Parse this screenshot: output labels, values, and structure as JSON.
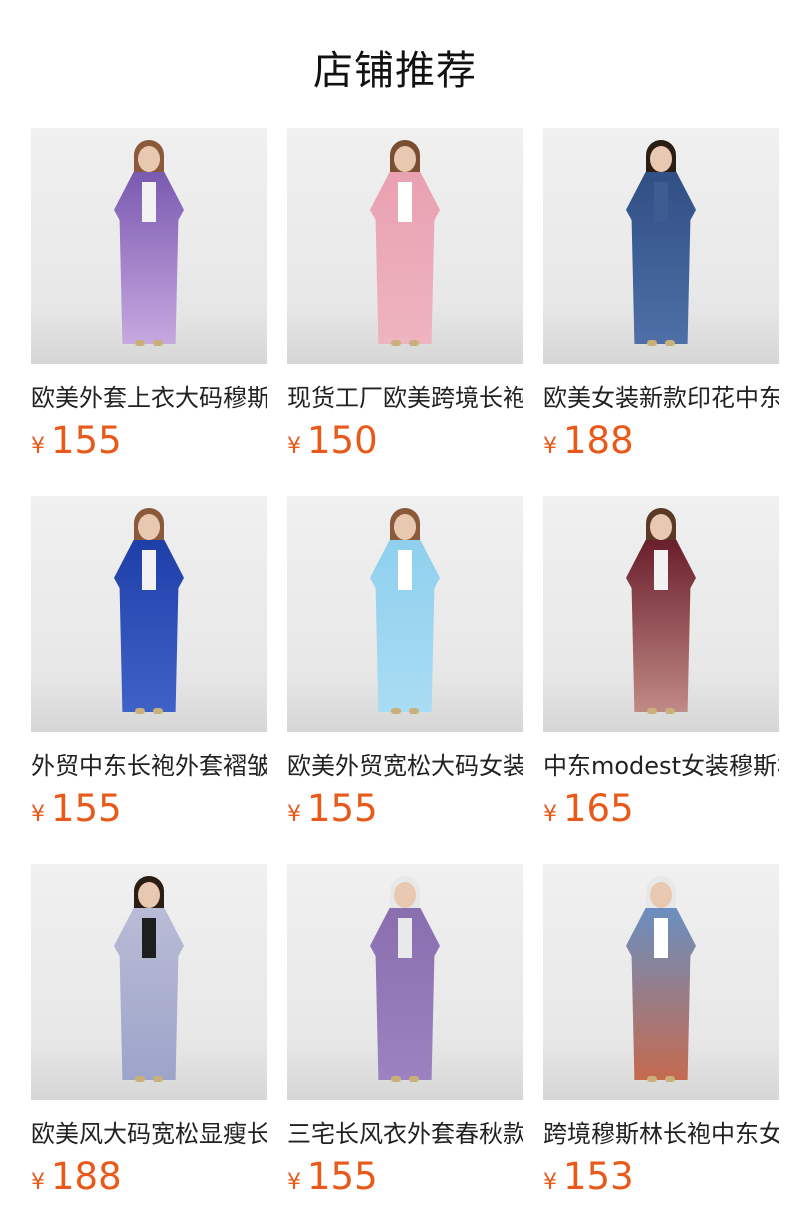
{
  "page": {
    "title": "店铺推荐"
  },
  "currency_symbol": "¥",
  "products": [
    {
      "name": "欧美外套上衣大码穆斯",
      "price": "155",
      "coat_colors": [
        "#7a5ab0",
        "#c7a8e0"
      ],
      "inner_color": "#f2f2f2",
      "legs_color": "#cda7d9",
      "hair_color": "#8a5a3a"
    },
    {
      "name": "现货工厂欧美跨境长袍",
      "price": "150",
      "coat_colors": [
        "#e9a1b0",
        "#eeb4c0"
      ],
      "inner_color": "#ffffff",
      "legs_color": "#1e1e1e",
      "hair_color": "#7a4e30"
    },
    {
      "name": "欧美女装新款印花中东",
      "price": "188",
      "coat_colors": [
        "#2f4f85",
        "#4f6fa8"
      ],
      "inner_color": "#3d5c92",
      "legs_color": "#2f4f85",
      "hair_color": "#2a1d14"
    },
    {
      "name": "外贸中东长袍外套褶皱",
      "price": "155",
      "coat_colors": [
        "#1f3fa8",
        "#3f62c8"
      ],
      "inner_color": "#f2f2f2",
      "legs_color": "#1e1e1e",
      "hair_color": "#8a5a3a"
    },
    {
      "name": "欧美外贸宽松大码女装",
      "price": "155",
      "coat_colors": [
        "#8fd0ee",
        "#a9dcf3"
      ],
      "inner_color": "#ffffff",
      "legs_color": "#8fd0ee",
      "hair_color": "#8a5a3a"
    },
    {
      "name": "中东modest女装穆斯林",
      "price": "165",
      "coat_colors": [
        "#6a1f2c",
        "#c08a86"
      ],
      "inner_color": "#f2f2f2",
      "legs_color": "#7fa6d2",
      "hair_color": "#5a3a26"
    },
    {
      "name": "欧美风大码宽松显瘦长",
      "price": "188",
      "coat_colors": [
        "#b9bcd6",
        "#9da4c9"
      ],
      "inner_color": "#1e1e1e",
      "legs_color": "#1e1e1e",
      "hair_color": "#2a1d14"
    },
    {
      "name": "三宅长风衣外套春秋款",
      "price": "155",
      "coat_colors": [
        "#8a6fb0",
        "#9c82c0"
      ],
      "inner_color": "#e9e9e9",
      "legs_color": "#8a6fb0",
      "hair_color": "#e8e8e8"
    },
    {
      "name": "跨境穆斯林长袍中东女",
      "price": "153",
      "coat_colors": [
        "#6a8fc0",
        "#c56a4f"
      ],
      "inner_color": "#ffffff",
      "legs_color": "#e9e9e9",
      "hair_color": "#e8e8e8"
    }
  ]
}
